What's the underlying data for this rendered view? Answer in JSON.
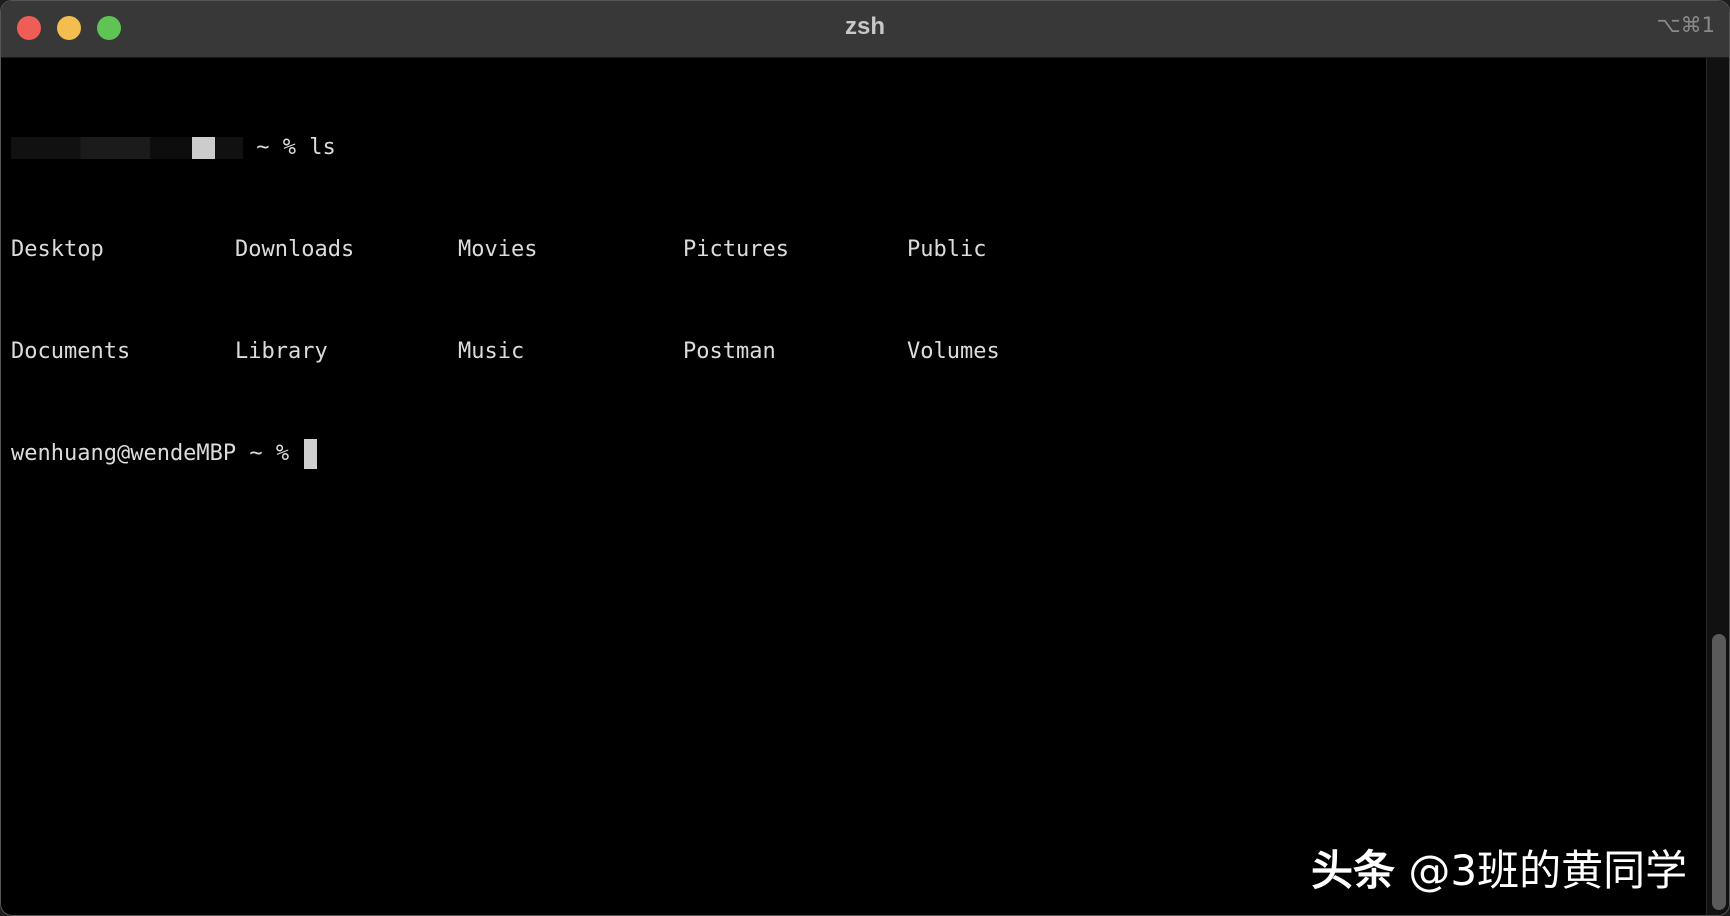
{
  "window": {
    "title": "zsh",
    "shortcut": "⌥⌘1"
  },
  "terminal": {
    "command_line": {
      "prompt_suffix": " ~ % ",
      "command": "ls"
    },
    "ls_output": [
      [
        "Desktop",
        "Downloads",
        "Movies",
        "Pictures",
        "Public"
      ],
      [
        "Documents",
        "Library",
        "Music",
        "Postman",
        "Volumes"
      ]
    ],
    "current_prompt": "wenhuang@wendeMBP ~ % "
  },
  "watermark": {
    "brand": "头条",
    "handle": "@3班的黄同学"
  },
  "colors": {
    "close": "#ee5e57",
    "minimize": "#f4bd4f",
    "maximize": "#5fc454"
  }
}
